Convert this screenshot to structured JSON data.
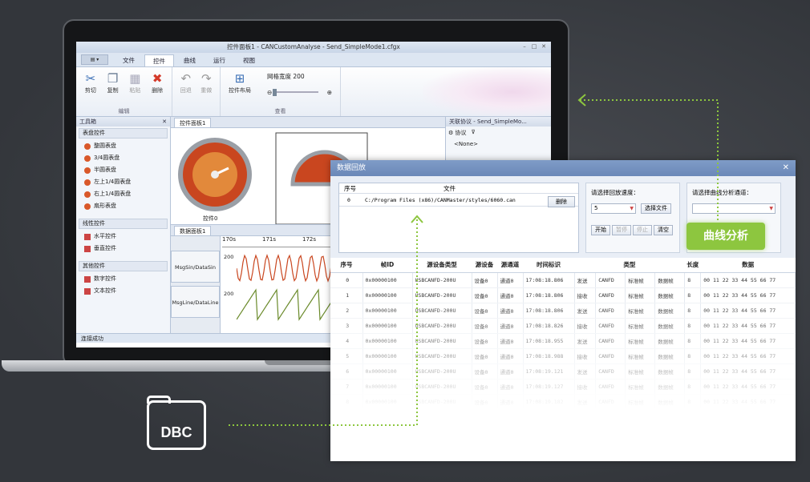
{
  "window": {
    "title": "控件面板1 - CANCustomAnalyse - Send_SimpleMode1.cfgx"
  },
  "menu": {
    "tabs": [
      "文件",
      "控件",
      "曲线",
      "运行",
      "视图"
    ],
    "active": "控件"
  },
  "ribbon": {
    "edit_group": {
      "label": "编辑",
      "buttons": [
        "剪切",
        "复制",
        "粘贴",
        "删除"
      ]
    },
    "undo_buttons": [
      "回退",
      "重做"
    ],
    "view_group": {
      "label": "查看",
      "layout_button": "控件布局",
      "grid_label": "网格宽度",
      "grid_value": "200"
    }
  },
  "toolbox": {
    "title": "工具箱",
    "categories": [
      {
        "name": "表盘控件",
        "items": [
          "整圆表盘",
          "3/4圆表盘",
          "半圆表盘",
          "左上1/4圆表盘",
          "右上1/4圆表盘",
          "扇形表盘"
        ]
      },
      {
        "name": "线性控件",
        "items": [
          "水平控件",
          "垂直控件"
        ]
      },
      {
        "name": "其他控件",
        "items": [
          "数字控件",
          "文本控件"
        ]
      }
    ]
  },
  "panels": {
    "control_tab": "控件面板1",
    "gauge_label": "控件0",
    "data_tab": "数据面板1",
    "time_ticks": [
      "170s",
      "171s",
      "172s"
    ],
    "signals": [
      "MsgSin/DataSin",
      "MsgLine/DataLine"
    ],
    "y_tick": "200",
    "right_title": "关联协议 - Send_SimpleMo...",
    "right_proto": "协议",
    "right_node": "<None>"
  },
  "status": "连接成功",
  "popup": {
    "title": "数据回放",
    "file_headers": [
      "序号",
      "文件"
    ],
    "file_row": {
      "index": "0",
      "path": "C:/Program Files (x86)/CANMaster/styles/6060.can"
    },
    "delete_button": "删除",
    "speed_label": "请选择回放速度：",
    "speed_value": "5",
    "choose_file_button": "选择文件",
    "play_buttons": [
      "开始",
      "暂停",
      "停止",
      "清空"
    ],
    "analysis_label": "请选择曲线分析通道：",
    "table_headers": [
      "序号",
      "帧ID",
      "源设备类型",
      "源设备",
      "源通道",
      "时间标识",
      "类型",
      "长度",
      "数据"
    ],
    "rows": [
      [
        "0",
        "0x00000100",
        "USBCANFD-200U",
        "设备0",
        "通道0",
        "17:08:18.806",
        "发送",
        "CANFD",
        "标准帧",
        "数据帧",
        "8",
        "00 11 22 33 44 55 66 77"
      ],
      [
        "1",
        "0x00000100",
        "USBCANFD-200U",
        "设备0",
        "通道0",
        "17:08:18.806",
        "接收",
        "CANFD",
        "标准帧",
        "数据帧",
        "8",
        "00 11 22 33 44 55 66 77"
      ],
      [
        "2",
        "0x00000100",
        "USBCANFD-200U",
        "设备0",
        "通道0",
        "17:08:18.806",
        "发送",
        "CANFD",
        "标准帧",
        "数据帧",
        "8",
        "00 11 22 33 44 55 66 77"
      ],
      [
        "3",
        "0x00000100",
        "USBCANFD-200U",
        "设备0",
        "通道0",
        "17:08:18.826",
        "接收",
        "CANFD",
        "标准帧",
        "数据帧",
        "8",
        "00 11 22 33 44 55 66 77"
      ],
      [
        "4",
        "0x00000100",
        "USBCANFD-200U",
        "设备0",
        "通道0",
        "17:08:18.955",
        "发送",
        "CANFD",
        "标准帧",
        "数据帧",
        "8",
        "00 11 22 33 44 55 66 77"
      ],
      [
        "5",
        "0x00000100",
        "USBCANFD-200U",
        "设备0",
        "通道0",
        "17:08:18.988",
        "接收",
        "CANFD",
        "标准帧",
        "数据帧",
        "8",
        "00 11 22 33 44 55 66 77"
      ],
      [
        "6",
        "0x00000100",
        "USBCANFD-200U",
        "设备0",
        "通道0",
        "17:08:19.121",
        "发送",
        "CANFD",
        "标准帧",
        "数据帧",
        "8",
        "00 11 22 33 44 55 66 77"
      ],
      [
        "7",
        "0x00000100",
        "USBCANFD-200U",
        "设备0",
        "通道0",
        "17:08:19.127",
        "接收",
        "CANFD",
        "标准帧",
        "数据帧",
        "8",
        "00 11 22 33 44 55 66 77"
      ],
      [
        "8",
        "0x00000100",
        "USBCANFD-200U",
        "设备0",
        "通道0",
        "17:08:19.182",
        "发送",
        "CANFD",
        "标准帧",
        "数据帧",
        "8",
        "00 11 22 33 44 55 66 77"
      ]
    ]
  },
  "badge": "曲线分析",
  "dbc_label": "DBC",
  "colors": {
    "accent_green": "#8dc63f",
    "popup_header": "#6a88b8",
    "gauge_orange": "#d9582a"
  }
}
